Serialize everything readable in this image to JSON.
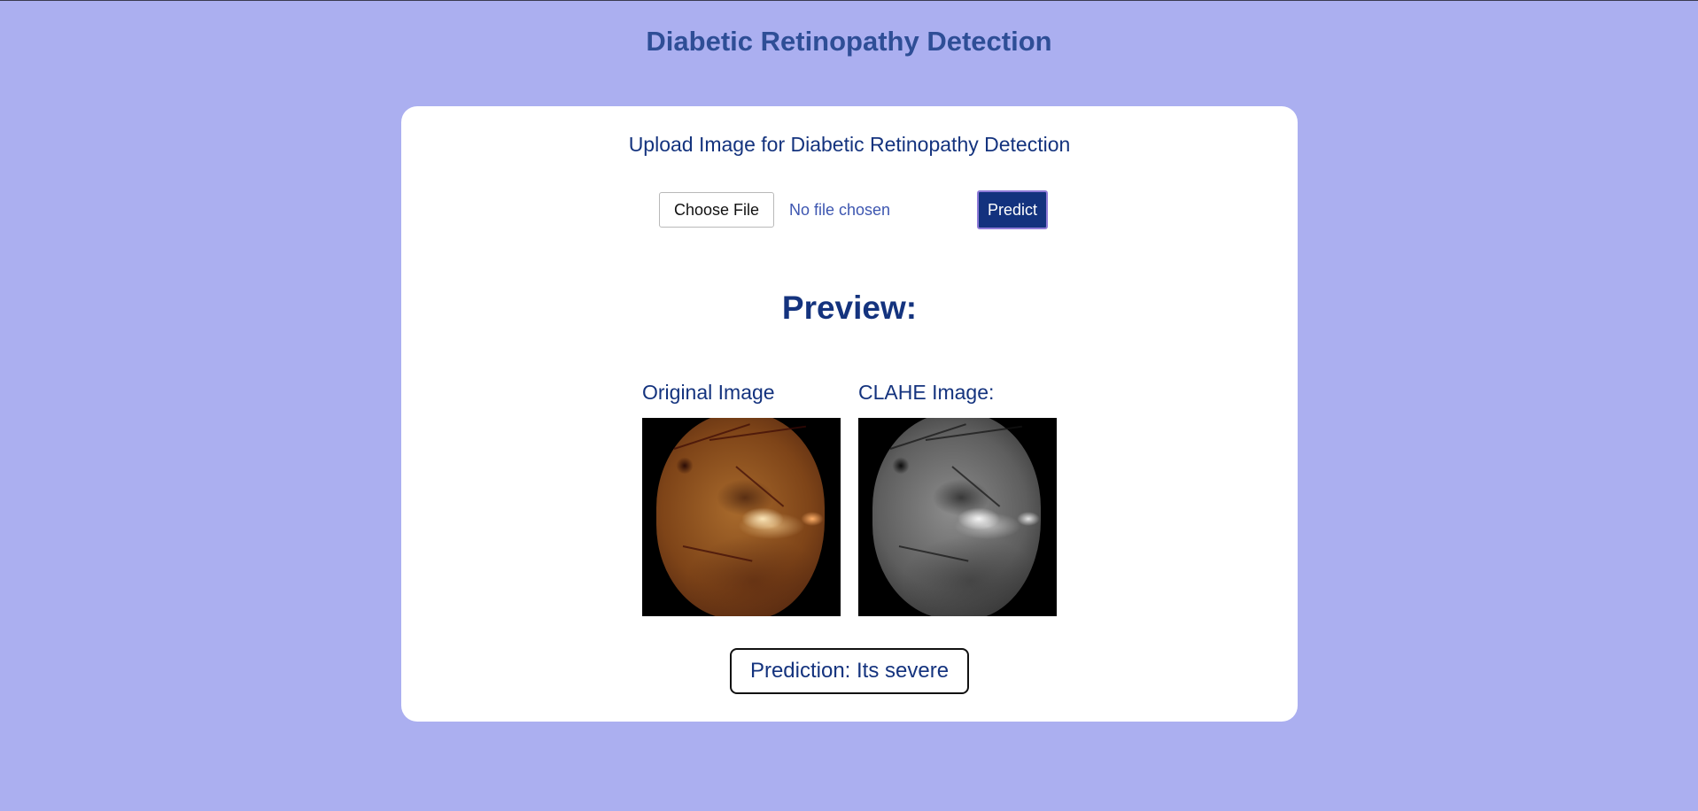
{
  "header": {
    "title": "Diabetic Retinopathy Detection"
  },
  "upload": {
    "heading": "Upload Image for Diabetic Retinopathy Detection",
    "choose_file_label": "Choose File",
    "file_status": "No file chosen",
    "predict_label": "Predict"
  },
  "preview": {
    "heading": "Preview:",
    "original_label": "Original Image",
    "clahe_label": "CLAHE Image:"
  },
  "result": {
    "prediction_text": "Prediction: Its severe"
  },
  "colors": {
    "background": "#abaff0",
    "title": "#2e4e96",
    "text": "#14337e",
    "button": "#13327e",
    "card": "#ffffff"
  }
}
